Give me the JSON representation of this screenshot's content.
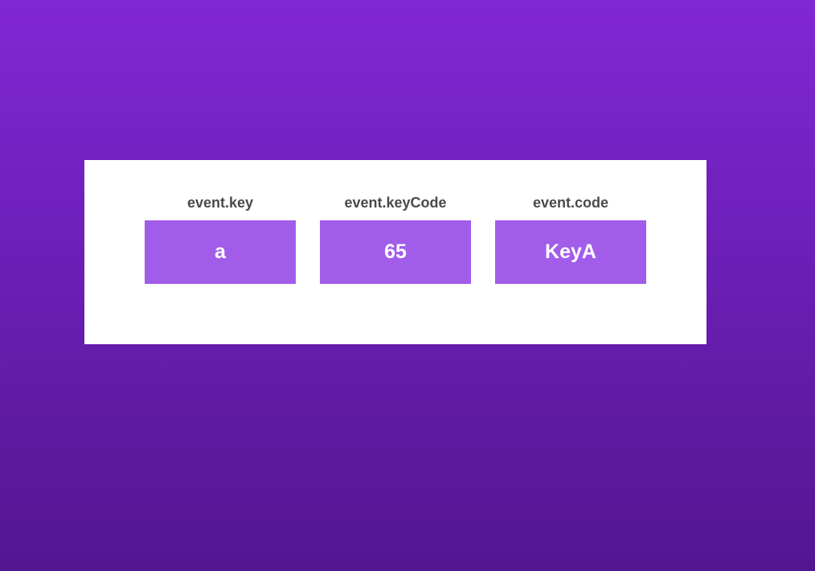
{
  "colors": {
    "background_top": "#8127d5",
    "background_bottom": "#531690",
    "card_background": "#ffffff",
    "value_box": "#a15de9",
    "label_text": "#4a4a4a",
    "value_text": "#ffffff"
  },
  "key_info": [
    {
      "label": "event.key",
      "value": "a"
    },
    {
      "label": "event.keyCode",
      "value": "65"
    },
    {
      "label": "event.code",
      "value": "KeyA"
    }
  ]
}
